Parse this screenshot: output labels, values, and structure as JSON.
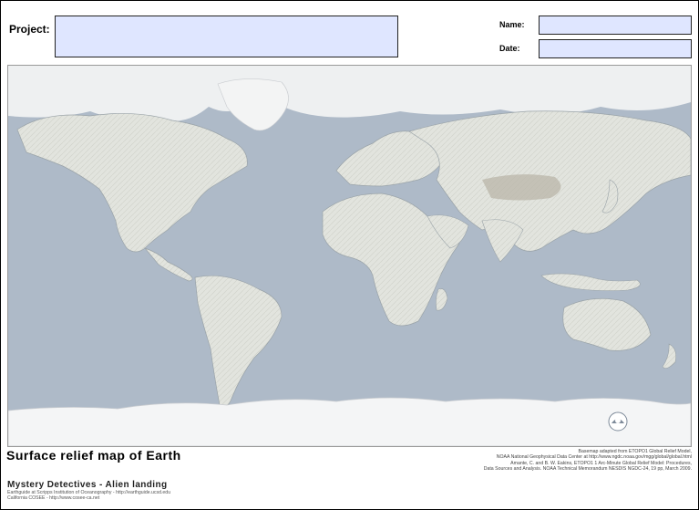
{
  "header": {
    "project_label": "Project:",
    "project_value": "",
    "name_label": "Name:",
    "name_value": "",
    "date_label": "Date:",
    "date_value": ""
  },
  "map": {
    "title": "Surface relief map of Earth",
    "credit_lines": [
      "Basemap adapted from ETOPO1 Global Relief Model,",
      "NOAA National Geophysical Data Center at http://www.ngdc.noaa.gov/mgg/global/global.html",
      "Amante, C. and B. W. Eakins, ETOPO1 1 Arc-Minute Global Relief Model: Procedures,",
      "Data Sources and Analysis. NOAA Technical Memorandum NESDIS NGDC-24, 19 pp, March 2009."
    ],
    "colors": {
      "ocean": "#aebac8",
      "land": "#e4e6e0",
      "ice": "#f4f5f6",
      "mountain": "#b9b6a8"
    },
    "logo_icon": "noaa-logo-icon"
  },
  "footer": {
    "subtitle": "Mystery Detectives - Alien landing",
    "line1": "Earthguide at Scripps Institution of Oceanography - http://earthguide.ucsd.edu",
    "line2": "California COSEE - http://www.cosee-ca.net"
  }
}
